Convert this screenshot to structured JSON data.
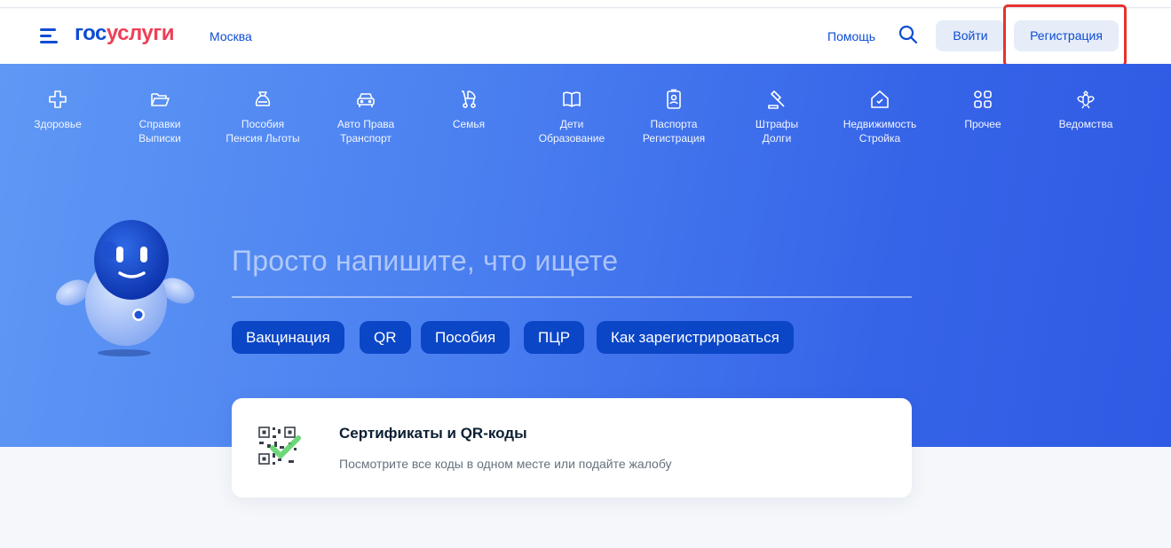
{
  "header": {
    "logo_part1": "гос",
    "logo_part2": "услуги",
    "city": "Москва",
    "help": "Помощь",
    "login": "Войти",
    "register": "Регистрация"
  },
  "categories": [
    {
      "line1": "Здоровье",
      "line2": "",
      "icon": "medical-cross-icon"
    },
    {
      "line1": "Справки",
      "line2": "Выписки",
      "icon": "folder-icon"
    },
    {
      "line1": "Пособия",
      "line2": "Пенсия Льготы",
      "icon": "money-bag-icon"
    },
    {
      "line1": "Авто Права",
      "line2": "Транспорт",
      "icon": "car-icon"
    },
    {
      "line1": "Семья",
      "line2": "",
      "icon": "stroller-icon"
    },
    {
      "line1": "Дети",
      "line2": "Образование",
      "icon": "book-icon"
    },
    {
      "line1": "Паспорта",
      "line2": "Регистрация",
      "icon": "passport-icon"
    },
    {
      "line1": "Штрафы",
      "line2": "Долги",
      "icon": "gavel-icon"
    },
    {
      "line1": "Недвижимость",
      "line2": "Стройка",
      "icon": "house-icon"
    },
    {
      "line1": "Прочее",
      "line2": "",
      "icon": "grid-icon"
    },
    {
      "line1": "Ведомства",
      "line2": "",
      "icon": "coat-of-arms-icon"
    }
  ],
  "search": {
    "placeholder": "Просто напишите, что ищете"
  },
  "chips": [
    "Вакцинация",
    "QR",
    "Пособия",
    "ПЦР",
    "Как зарегистрироваться"
  ],
  "card": {
    "title": "Сертификаты и QR-коды",
    "subtitle": "Посмотрите все коды в одном месте или подайте жалобу",
    "icon": "qr-code-check-icon"
  },
  "colors": {
    "brand_blue": "#0d4cd3",
    "brand_red": "#ee3f58",
    "highlight": "#e5322f",
    "chip_bg": "#0b46c7"
  }
}
